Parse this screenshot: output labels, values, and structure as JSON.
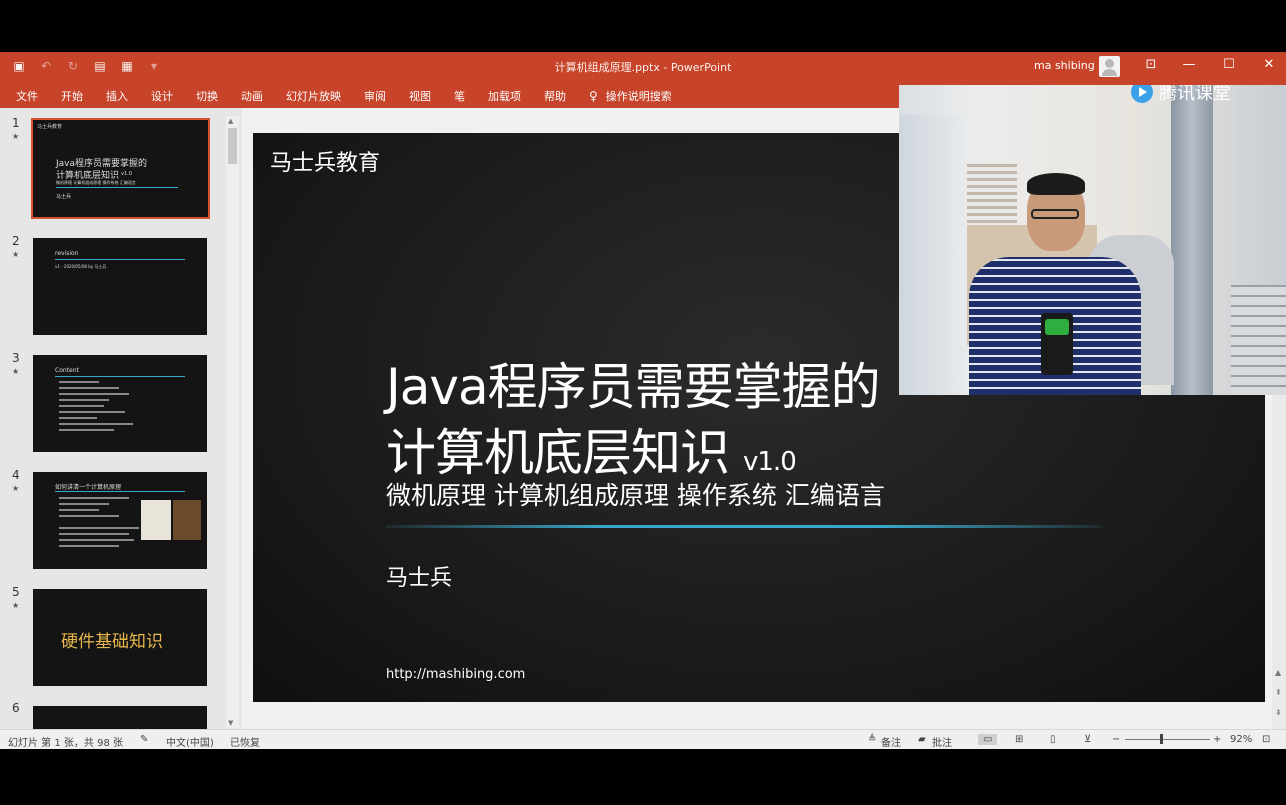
{
  "window": {
    "title": "计算机组成原理.pptx - PowerPoint",
    "user": "ma shibing"
  },
  "ribbon": {
    "tabs": [
      "文件",
      "开始",
      "插入",
      "设计",
      "切换",
      "动画",
      "幻灯片放映",
      "审阅",
      "视图",
      "笔",
      "加载项",
      "帮助"
    ],
    "tell_me": "操作说明搜索"
  },
  "thumbnails": {
    "numbers": [
      "1",
      "2",
      "3",
      "4",
      "5",
      "6"
    ],
    "slide1": {
      "brand": "马士兵教育",
      "title1": "Java程序员需要掌握的",
      "title2": "计算机底层知识",
      "ver": "v1.0",
      "sub": "微机原理 计算机组成原理 操作系统 汇编语言",
      "author": "马士兵"
    },
    "slide2": {
      "title": "revision",
      "item": "v1 - 2020/05/08 by 马士兵"
    },
    "slide3": {
      "title": "Content"
    },
    "slide4": {
      "title": "如何讲清一个计算机原理"
    },
    "slide5": {
      "title": "硬件基础知识"
    }
  },
  "slide": {
    "brand": "马士兵教育",
    "title_line1": "Java程序员需要掌握的",
    "title_line2": "计算机底层知识",
    "version": "v1.0",
    "subtitle": "微机原理 计算机组成原理 操作系统 汇编语言",
    "author": "马士兵",
    "url": "http://mashibing.com"
  },
  "status": {
    "slide_info": "幻灯片 第 1 张，共 98 张",
    "language": "中文(中国)",
    "recovered": "已恢复",
    "notes": "备注",
    "comments": "批注",
    "zoom": "92%"
  },
  "overlay": {
    "logo_text": "腾讯课堂"
  },
  "colors": {
    "accent": "#c7432a",
    "divider": "#3aa6c8",
    "thumb_highlight": "#e8b84a"
  }
}
